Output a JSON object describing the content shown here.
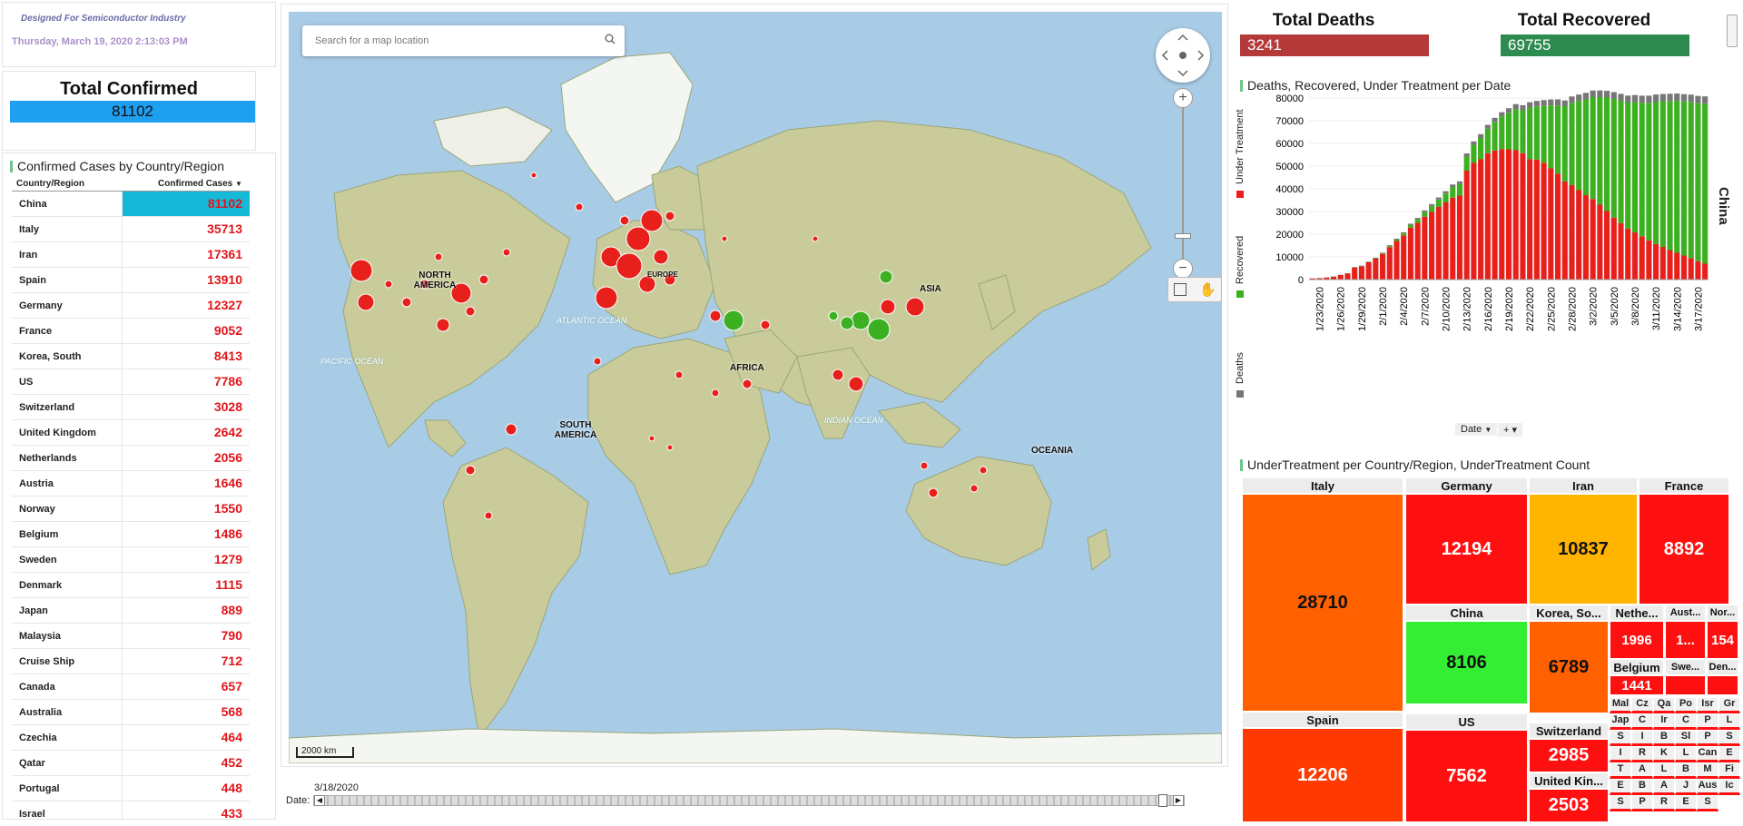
{
  "header": {
    "tagline": "Designed For Semiconductor Industry",
    "datetime": "Thursday, March 19, 2020 2:13:03 PM"
  },
  "kpis": {
    "confirmed": {
      "title": "Total Confirmed",
      "value": "81102",
      "color": "#1e9ff0"
    },
    "deaths": {
      "title": "Total Deaths",
      "value": "3241",
      "color": "#b43a3a"
    },
    "recovered": {
      "title": "Total Recovered",
      "value": "69755",
      "color": "#2e8b50"
    }
  },
  "country_table": {
    "title": "Confirmed Cases by Country/Region",
    "col_country": "Country/Region",
    "col_cases": "Confirmed Cases",
    "rows": [
      {
        "country": "China",
        "cases": "81102"
      },
      {
        "country": "Italy",
        "cases": "35713"
      },
      {
        "country": "Iran",
        "cases": "17361"
      },
      {
        "country": "Spain",
        "cases": "13910"
      },
      {
        "country": "Germany",
        "cases": "12327"
      },
      {
        "country": "France",
        "cases": "9052"
      },
      {
        "country": "Korea, South",
        "cases": "8413"
      },
      {
        "country": "US",
        "cases": "7786"
      },
      {
        "country": "Switzerland",
        "cases": "3028"
      },
      {
        "country": "United Kingdom",
        "cases": "2642"
      },
      {
        "country": "Netherlands",
        "cases": "2056"
      },
      {
        "country": "Austria",
        "cases": "1646"
      },
      {
        "country": "Norway",
        "cases": "1550"
      },
      {
        "country": "Belgium",
        "cases": "1486"
      },
      {
        "country": "Sweden",
        "cases": "1279"
      },
      {
        "country": "Denmark",
        "cases": "1115"
      },
      {
        "country": "Japan",
        "cases": "889"
      },
      {
        "country": "Malaysia",
        "cases": "790"
      },
      {
        "country": "Cruise Ship",
        "cases": "712"
      },
      {
        "country": "Canada",
        "cases": "657"
      },
      {
        "country": "Australia",
        "cases": "568"
      },
      {
        "country": "Czechia",
        "cases": "464"
      },
      {
        "country": "Qatar",
        "cases": "452"
      },
      {
        "country": "Portugal",
        "cases": "448"
      },
      {
        "country": "Israel",
        "cases": "433"
      }
    ]
  },
  "map": {
    "search_placeholder": "Search for a map location",
    "scale_label": "2000 km",
    "continents": [
      "NORTH AMERICA",
      "SOUTH AMERICA",
      "AFRICA",
      "ASIA",
      "OCEANIA",
      "EUROPE"
    ],
    "oceans": [
      "ATLANTIC OCEAN",
      "PACIFIC OCEAN",
      "INDIAN OCEAN"
    ],
    "zoom_in": "+",
    "zoom_out": "−"
  },
  "date_slider": {
    "label": "Date:",
    "value": "3/18/2020"
  },
  "chart_panel": {
    "title": "Deaths, Recovered, Under Treatment per Date",
    "trellis_label": "China",
    "x_axis_control": "Date",
    "legend": [
      {
        "name": "Under Treatment",
        "color": "#e8201c"
      },
      {
        "name": "Recovered",
        "color": "#3cb021"
      },
      {
        "name": "Deaths",
        "color": "#777777"
      }
    ]
  },
  "chart_data": {
    "type": "bar",
    "stacked": true,
    "title": "Deaths, Recovered, Under Treatment per Date",
    "xlabel": "Date",
    "ylabel": "",
    "ylim": [
      0,
      80000
    ],
    "yticks": [
      0,
      10000,
      20000,
      30000,
      40000,
      50000,
      60000,
      70000,
      80000
    ],
    "xtick_labels": [
      "1/23/2020",
      "1/26/2020",
      "1/29/2020",
      "2/1/2020",
      "2/4/2020",
      "2/7/2020",
      "2/10/2020",
      "2/13/2020",
      "2/16/2020",
      "2/19/2020",
      "2/22/2020",
      "2/25/2020",
      "2/28/2020",
      "3/2/2020",
      "3/5/2020",
      "3/8/2020",
      "3/11/2020",
      "3/14/2020",
      "3/17/2020"
    ],
    "categories": [
      "1/22",
      "1/23",
      "1/24",
      "1/25",
      "1/26",
      "1/27",
      "1/28",
      "1/29",
      "1/30",
      "1/31",
      "2/1",
      "2/2",
      "2/3",
      "2/4",
      "2/5",
      "2/6",
      "2/7",
      "2/8",
      "2/9",
      "2/10",
      "2/11",
      "2/12",
      "2/13",
      "2/14",
      "2/15",
      "2/16",
      "2/17",
      "2/18",
      "2/19",
      "2/20",
      "2/21",
      "2/22",
      "2/23",
      "2/24",
      "2/25",
      "2/26",
      "2/27",
      "2/28",
      "2/29",
      "3/1",
      "3/2",
      "3/3",
      "3/4",
      "3/5",
      "3/6",
      "3/7",
      "3/8",
      "3/9",
      "3/10",
      "3/11",
      "3/12",
      "3/13",
      "3/14",
      "3/15",
      "3/16",
      "3/17",
      "3/18"
    ],
    "series": [
      {
        "name": "Under Treatment",
        "color": "#e8201c",
        "values": [
          500,
          600,
          900,
          1300,
          2000,
          2700,
          5300,
          5900,
          7600,
          9200,
          11300,
          14300,
          17000,
          19500,
          22900,
          25000,
          27700,
          29800,
          32000,
          34000,
          36100,
          37000,
          48000,
          51400,
          53000,
          55700,
          56900,
          57500,
          57400,
          57000,
          55700,
          53100,
          52900,
          51500,
          49000,
          46700,
          43300,
          41600,
          39400,
          37200,
          35500,
          33000,
          30200,
          27300,
          24900,
          22500,
          20800,
          19100,
          17300,
          15700,
          14400,
          13000,
          11800,
          10600,
          9500,
          8100,
          7000
        ]
      },
      {
        "name": "Recovered",
        "color": "#3cb021",
        "values": [
          30,
          35,
          40,
          40,
          50,
          60,
          100,
          120,
          140,
          210,
          280,
          470,
          620,
          850,
          1150,
          1550,
          2050,
          2650,
          3280,
          3940,
          4680,
          5150,
          6220,
          7980,
          9400,
          10800,
          12600,
          14400,
          16100,
          18200,
          18900,
          22700,
          23400,
          25000,
          27700,
          30000,
          32900,
          36300,
          39300,
          42200,
          44900,
          47400,
          50000,
          52300,
          53900,
          55500,
          57400,
          58800,
          60600,
          62700,
          64200,
          65700,
          67000,
          67900,
          68800,
          69600,
          70500
        ]
      },
      {
        "name": "Deaths",
        "color": "#777777",
        "values": [
          17,
          18,
          26,
          42,
          56,
          82,
          131,
          133,
          171,
          213,
          259,
          361,
          425,
          490,
          562,
          632,
          717,
          804,
          904,
          1011,
          1112,
          1117,
          1369,
          1521,
          1663,
          1666,
          1770,
          1868,
          2007,
          2122,
          2239,
          2348,
          2445,
          2595,
          2665,
          2717,
          2746,
          2790,
          2837,
          2872,
          2914,
          2947,
          2983,
          3015,
          3044,
          3072,
          3100,
          3123,
          3139,
          3161,
          3172,
          3180,
          3193,
          3203,
          3217,
          3230,
          3241
        ]
      }
    ]
  },
  "treemap": {
    "title": "UnderTreatment per Country/Region, UnderTreatment Count",
    "cells": [
      {
        "name": "Italy",
        "value": "28710",
        "color": "#ff6000"
      },
      {
        "name": "Germany",
        "value": "12194",
        "color": "#ff1010"
      },
      {
        "name": "Iran",
        "value": "10837",
        "color": "#ffb400"
      },
      {
        "name": "France",
        "value": "8892",
        "color": "#ff1010"
      },
      {
        "name": "China",
        "value": "8106",
        "color": "#33ee33"
      },
      {
        "name": "Korea, So...",
        "value": "6789",
        "color": "#ff6000"
      },
      {
        "name": "Nethe...",
        "value": "1996",
        "color": "#ff1010"
      },
      {
        "name": "Aust...",
        "value": "1...",
        "color": "#ff1010"
      },
      {
        "name": "Nor...",
        "value": "154",
        "color": "#ff1010"
      },
      {
        "name": "Belgium",
        "value": "1441",
        "color": "#ff1010"
      },
      {
        "name": "Swe...",
        "value": "",
        "color": "#ff1010"
      },
      {
        "name": "Den...",
        "value": "",
        "color": "#ff1010"
      },
      {
        "name": "Spain",
        "value": "12206",
        "color": "#ff3a00"
      },
      {
        "name": "US",
        "value": "7562",
        "color": "#ff1010"
      },
      {
        "name": "Switzerland",
        "value": "2985",
        "color": "#ff1010"
      },
      {
        "name": "United Kin...",
        "value": "2503",
        "color": "#ff1010"
      }
    ],
    "tiny": [
      "Mal",
      "Cz",
      "Qa",
      "Po",
      "Isr",
      "Gr",
      "Jap",
      "C",
      "Ir",
      "C",
      "P",
      "L",
      "S",
      "I",
      "B",
      "Sl",
      "P",
      "S",
      "I",
      "R",
      "K",
      "L",
      "Can",
      "E",
      "T",
      "A",
      "L",
      "B",
      "M",
      "Fi",
      "E",
      "B",
      "A",
      "J",
      "Aus",
      "Ic",
      "S",
      "P",
      "R",
      "E",
      "S"
    ]
  }
}
